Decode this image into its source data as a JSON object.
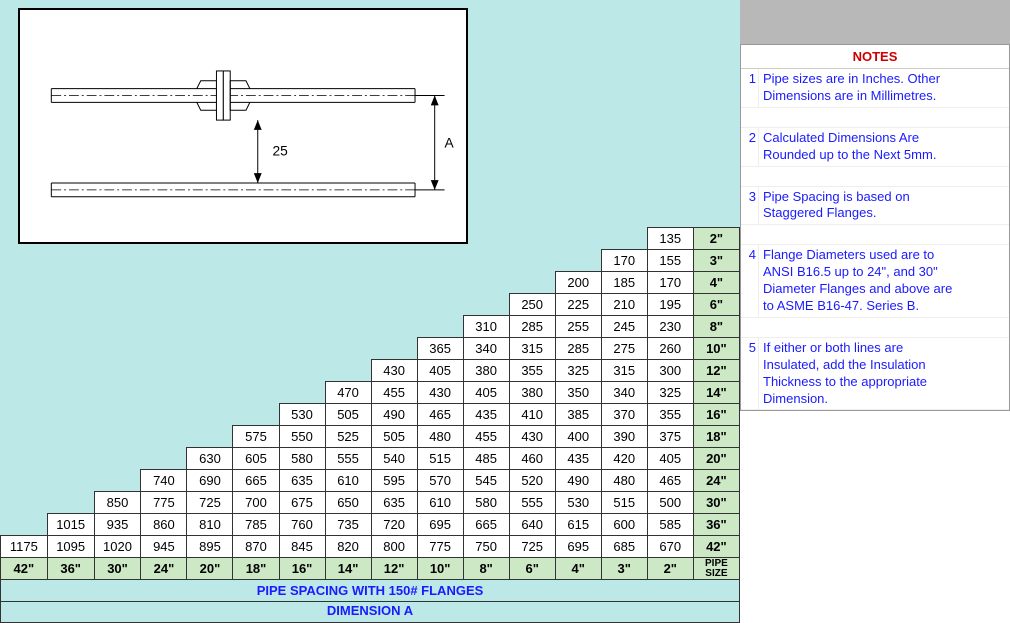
{
  "notes_title": "NOTES",
  "notes": [
    {
      "n": "1",
      "lines": [
        "Pipe sizes are in Inches. Other",
        "Dimensions are in Millimetres."
      ]
    },
    {
      "n": "2",
      "lines": [
        "Calculated Dimensions Are",
        "Rounded up to the Next 5mm."
      ]
    },
    {
      "n": "3",
      "lines": [
        "Pipe Spacing is based on",
        "Staggered Flanges."
      ]
    },
    {
      "n": "4",
      "lines": [
        "Flange Diameters used are to",
        "ANSI B16.5 up to 24\", and 30\"",
        "Diameter Flanges and above are",
        "to ASME B16-47. Series B."
      ]
    },
    {
      "n": "5",
      "lines": [
        "If either or both lines are",
        "Insulated, add the Insulation",
        "Thickness to the appropriate",
        "Dimension."
      ]
    }
  ],
  "diagram": {
    "gap_label": "25",
    "dim_label": "A"
  },
  "sizes_col": [
    "2\"",
    "3\"",
    "4\"",
    "6\"",
    "8\"",
    "10\"",
    "12\"",
    "14\"",
    "16\"",
    "18\"",
    "20\"",
    "24\"",
    "30\"",
    "36\"",
    "42\""
  ],
  "sizes_row": [
    "42\"",
    "36\"",
    "30\"",
    "24\"",
    "20\"",
    "18\"",
    "16\"",
    "14\"",
    "12\"",
    "10\"",
    "8\"",
    "6\"",
    "4\"",
    "3\"",
    "2\""
  ],
  "pipe_size_label": "PIPE SIZE",
  "chart_data": {
    "type": "table",
    "title": "PIPE SPACING WITH 150# FLANGES — DIMENSION A",
    "rows": [
      [
        "",
        "",
        "",
        "",
        "",
        "",
        "",
        "",
        "",
        "",
        "",
        "",
        "",
        "135"
      ],
      [
        "",
        "",
        "",
        "",
        "",
        "",
        "",
        "",
        "",
        "",
        "",
        "",
        "170",
        "155"
      ],
      [
        "",
        "",
        "",
        "",
        "",
        "",
        "",
        "",
        "",
        "",
        "",
        "200",
        "185",
        "170"
      ],
      [
        "",
        "",
        "",
        "",
        "",
        "",
        "",
        "",
        "",
        "",
        "250",
        "225",
        "210",
        "195"
      ],
      [
        "",
        "",
        "",
        "",
        "",
        "",
        "",
        "",
        "",
        "310",
        "285",
        "255",
        "245",
        "230"
      ],
      [
        "",
        "",
        "",
        "",
        "",
        "",
        "",
        "",
        "365",
        "340",
        "315",
        "285",
        "275",
        "260"
      ],
      [
        "",
        "",
        "",
        "",
        "",
        "",
        "",
        "430",
        "405",
        "380",
        "355",
        "325",
        "315",
        "300"
      ],
      [
        "",
        "",
        "",
        "",
        "",
        "",
        "470",
        "455",
        "430",
        "405",
        "380",
        "350",
        "340",
        "325"
      ],
      [
        "",
        "",
        "",
        "",
        "",
        "530",
        "505",
        "490",
        "465",
        "435",
        "410",
        "385",
        "370",
        "355"
      ],
      [
        "",
        "",
        "",
        "",
        "575",
        "550",
        "525",
        "505",
        "480",
        "455",
        "430",
        "400",
        "390",
        "375"
      ],
      [
        "",
        "",
        "",
        "630",
        "605",
        "580",
        "555",
        "540",
        "515",
        "485",
        "460",
        "435",
        "420",
        "405"
      ],
      [
        "",
        "",
        "740",
        "690",
        "665",
        "635",
        "610",
        "595",
        "570",
        "545",
        "520",
        "490",
        "480",
        "465"
      ],
      [
        "",
        "850",
        "775",
        "725",
        "700",
        "675",
        "650",
        "635",
        "610",
        "580",
        "555",
        "530",
        "515",
        "500"
      ],
      [
        "1015",
        "935",
        "860",
        "810",
        "785",
        "760",
        "735",
        "720",
        "695",
        "665",
        "640",
        "615",
        "600",
        "585"
      ],
      [
        "1175",
        "1095",
        "1020",
        "945",
        "895",
        "870",
        "845",
        "820",
        "800",
        "775",
        "750",
        "725",
        "695",
        "685",
        "670"
      ]
    ]
  },
  "caption1": "PIPE SPACING WITH 150# FLANGES",
  "caption2": "DIMENSION A"
}
